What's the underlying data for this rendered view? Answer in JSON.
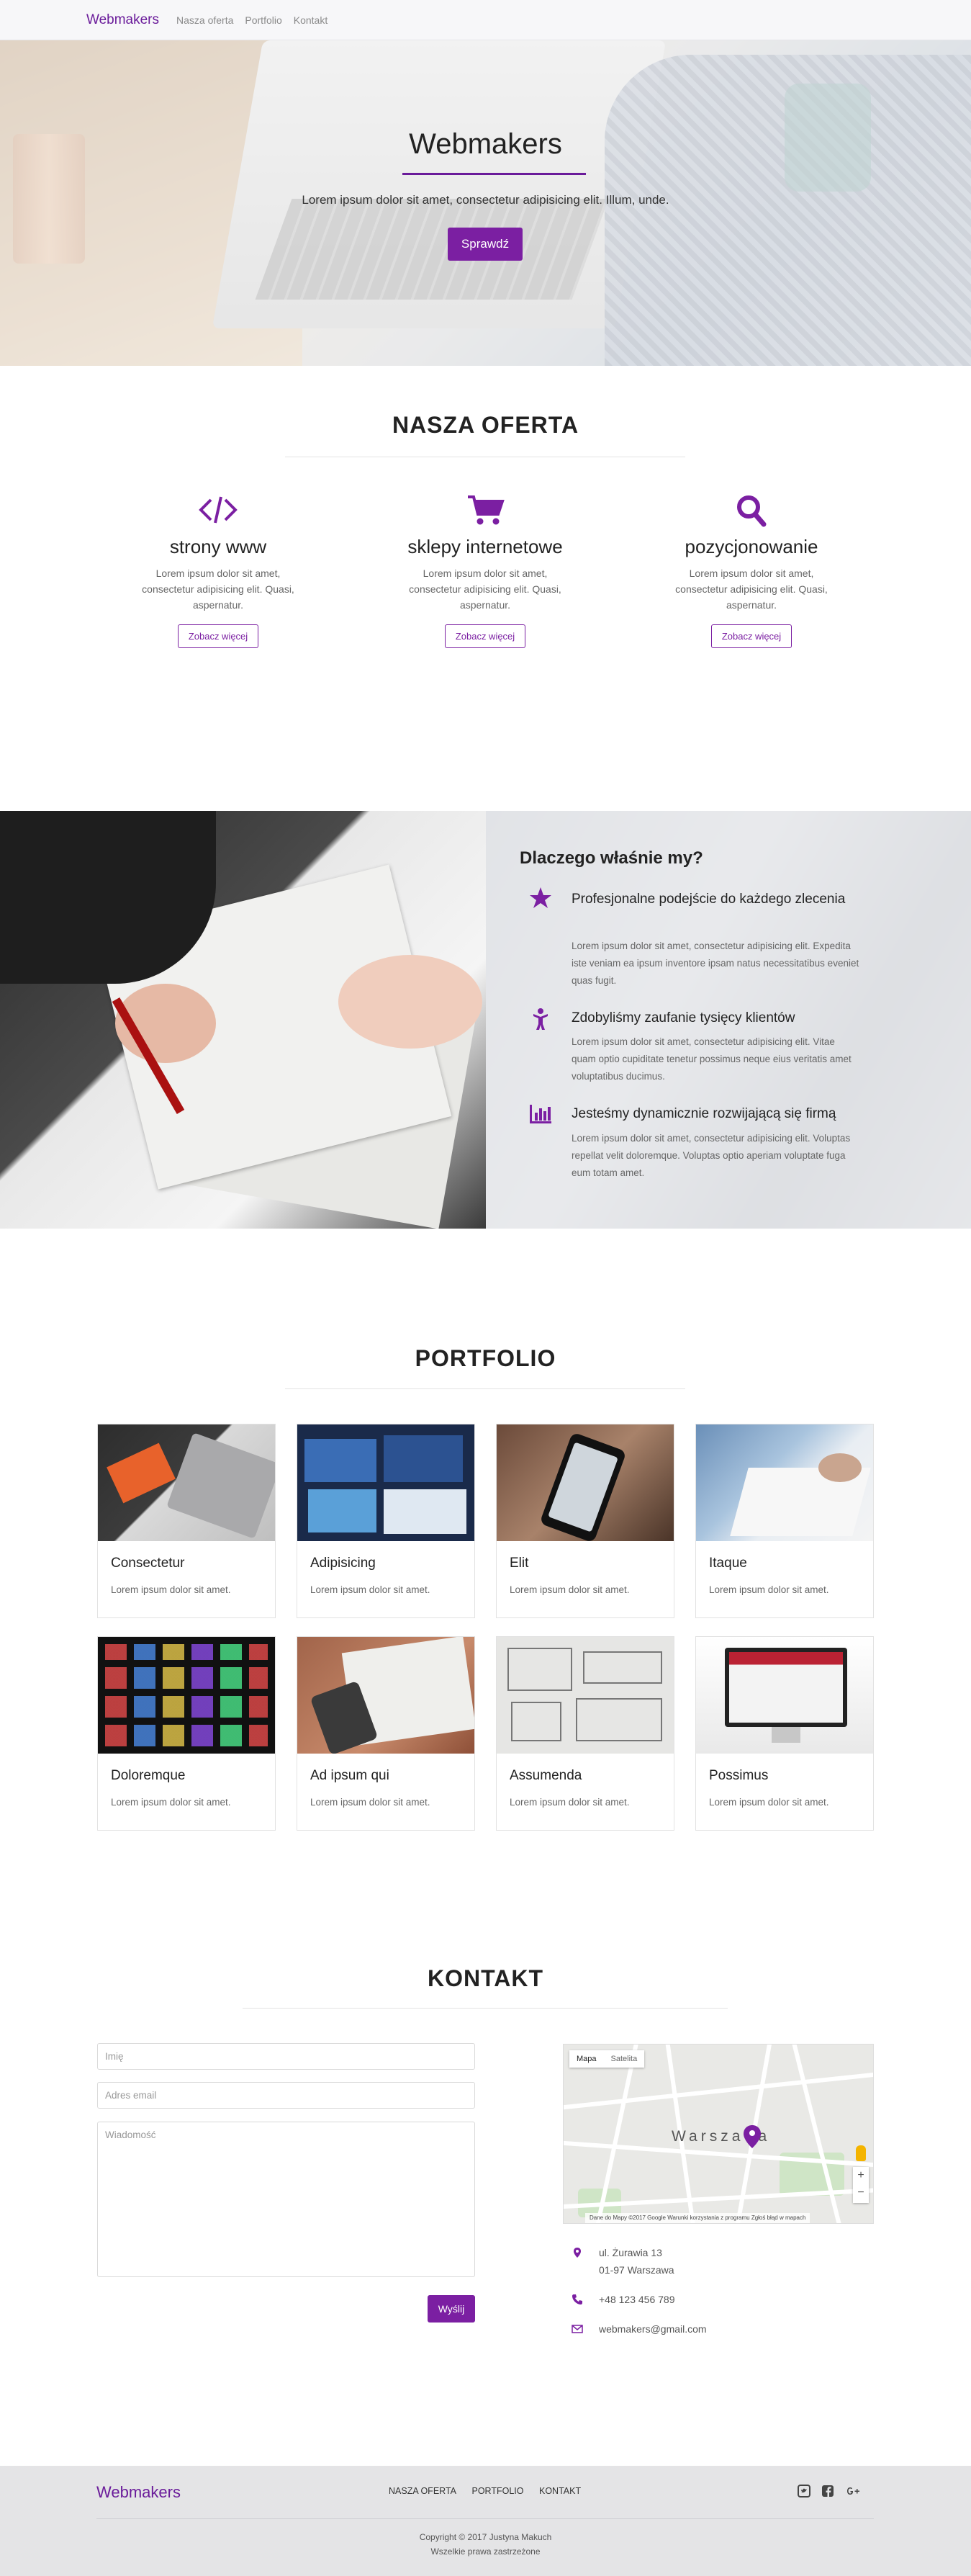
{
  "nav": {
    "brand": "Webmakers",
    "links": [
      "Nasza oferta",
      "Portfolio",
      "Kontakt"
    ]
  },
  "hero": {
    "title": "Webmakers",
    "subtitle": "Lorem ipsum dolor sit amet, consectetur adipisicing elit. Illum, unde.",
    "button": "Sprawdź"
  },
  "offer": {
    "heading": "NASZA OFERTA",
    "items": [
      {
        "icon": "code-icon",
        "title": "strony www",
        "text": "Lorem ipsum dolor sit amet, consectetur adipisicing elit. Quasi, aspernatur.",
        "button": "Zobacz więcej"
      },
      {
        "icon": "cart-icon",
        "title": "sklepy internetowe",
        "text": "Lorem ipsum dolor sit amet, consectetur adipisicing elit. Quasi, aspernatur.",
        "button": "Zobacz więcej"
      },
      {
        "icon": "search-icon",
        "title": "pozycjonowanie",
        "text": "Lorem ipsum dolor sit amet, consectetur adipisicing elit. Quasi, aspernatur.",
        "button": "Zobacz więcej"
      }
    ]
  },
  "why": {
    "heading": "Dlaczego właśnie my?",
    "items": [
      {
        "icon": "star-icon",
        "title": "Profesjonalne podejście do każdego zlecenia",
        "text": "Lorem ipsum dolor sit amet, consectetur adipisicing elit. Expedita iste veniam ea ipsum inventore ipsam natus necessitatibus eveniet quas fugit."
      },
      {
        "icon": "person-icon",
        "title": "Zdobyliśmy zaufanie tysięcy klientów",
        "text": "Lorem ipsum dolor sit amet, consectetur adipisicing elit. Vitae quam optio cupiditate tenetur possimus neque eius veritatis amet voluptatibus ducimus."
      },
      {
        "icon": "bar-chart-icon",
        "title": "Jesteśmy dynamicznie rozwijającą się firmą",
        "text": "Lorem ipsum dolor sit amet, consectetur adipisicing elit. Voluptas repellat velit doloremque. Voluptas optio aperiam voluptate fuga eum totam amet."
      }
    ]
  },
  "portfolio": {
    "heading": "PORTFOLIO",
    "items": [
      {
        "title": "Consectetur",
        "text": "Lorem ipsum dolor sit amet."
      },
      {
        "title": "Adipisicing",
        "text": "Lorem ipsum dolor sit amet."
      },
      {
        "title": "Elit",
        "text": "Lorem ipsum dolor sit amet."
      },
      {
        "title": "Itaque",
        "text": "Lorem ipsum dolor sit amet."
      },
      {
        "title": "Doloremque",
        "text": "Lorem ipsum dolor sit amet."
      },
      {
        "title": "Ad ipsum qui",
        "text": "Lorem ipsum dolor sit amet."
      },
      {
        "title": "Assumenda",
        "text": "Lorem ipsum dolor sit amet."
      },
      {
        "title": "Possimus",
        "text": "Lorem ipsum dolor sit amet."
      }
    ]
  },
  "contact": {
    "heading": "KONTAKT",
    "name_placeholder": "Imię",
    "email_placeholder": "Adres email",
    "message_placeholder": "Wiadomość",
    "send": "Wyślij",
    "map": {
      "tab_map": "Mapa",
      "tab_satellite": "Satelita",
      "city": "Warszawa",
      "footer": "Dane do Mapy ©2017 Google   Warunki korzystania z programu   Zgłoś błąd w mapach"
    },
    "address_line1": "ul. Żurawia 13",
    "address_line2": "01-97 Warszawa",
    "phone": "+48 123 456 789",
    "email": "webmakers@gmail.com"
  },
  "footer": {
    "brand": "Webmakers",
    "links": [
      "NASZA OFERTA",
      "PORTFOLIO",
      "KONTAKT"
    ],
    "copyright": "Copyright © 2017 Justyna Makuch",
    "rights": "Wszelkie prawa zastrzeżone"
  },
  "colors": {
    "accent": "#7b1fa2",
    "footer_bg": "#e4e4e6"
  }
}
